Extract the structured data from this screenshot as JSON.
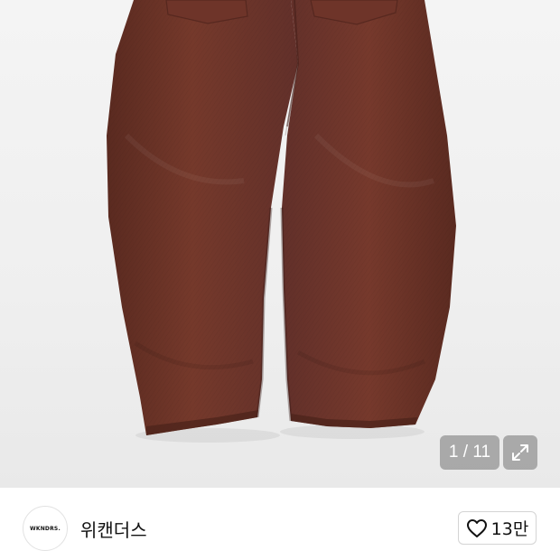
{
  "product_gallery": {
    "image_description": "brown wide-leg denim pants, back view",
    "counter": "1 / 11",
    "current_index": 1,
    "total_images": 11,
    "expand_icon": "expand-icon"
  },
  "seller": {
    "logo_text": "WKNDRS.",
    "name": "위캔더스"
  },
  "like": {
    "icon": "heart-icon",
    "count_label": "13만"
  },
  "colors": {
    "gallery_bg": "#efefef",
    "denim": "#6b3528",
    "counter_bg": "#969696"
  }
}
